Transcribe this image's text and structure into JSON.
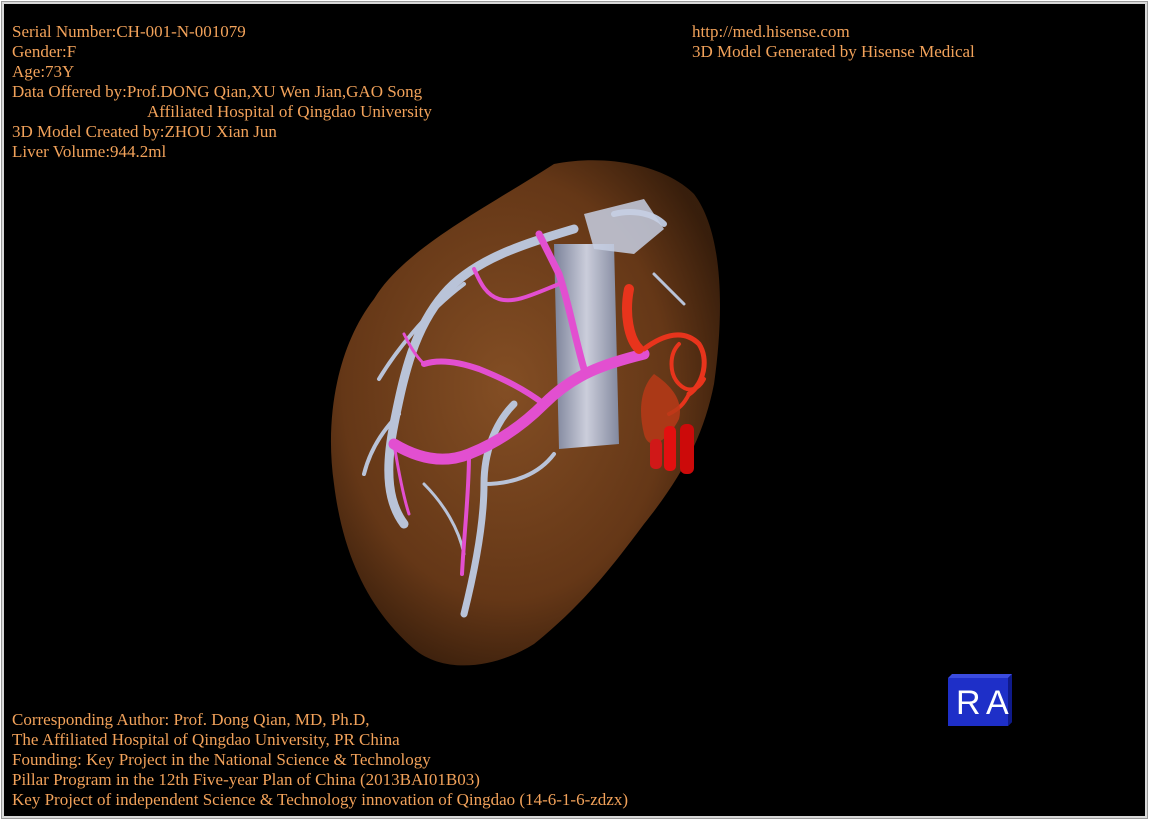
{
  "header_left": {
    "serial": "Serial Number:CH-001-N-001079",
    "gender": "Gender:F",
    "age": "Age:73Y",
    "data_offered": "Data Offered by:Prof.DONG Qian,XU Wen Jian,GAO Song",
    "hospital": "Affiliated Hospital of Qingdao University",
    "created_by": "3D Model Created by:ZHOU Xian Jun",
    "liver_volume": "Liver Volume:944.2ml"
  },
  "header_right": {
    "url": "http://med.hisense.com",
    "generated": "3D Model Generated by Hisense Medical"
  },
  "footer": {
    "line1": "Corresponding Author: Prof. Dong Qian, MD, Ph.D,",
    "line2": "The Affiliated Hospital of Qingdao University, PR China",
    "line3": "Founding: Key Project in the National Science & Technology",
    "line4": "Pillar Program in the 12th Five-year Plan of China (2013BAI01B03)",
    "line5": "Key Project of independent Science & Technology innovation of Qingdao (14-6-1-6-zdzx)"
  },
  "orientation": {
    "left": "R",
    "right": "A"
  },
  "colors": {
    "text": "#f2a25a",
    "liver": "#7a4520",
    "hepatic_vein": "#b9c3d8",
    "portal_vein": "#e24fd0",
    "artery": "#e8341c",
    "cube": "#1e2fc8"
  }
}
